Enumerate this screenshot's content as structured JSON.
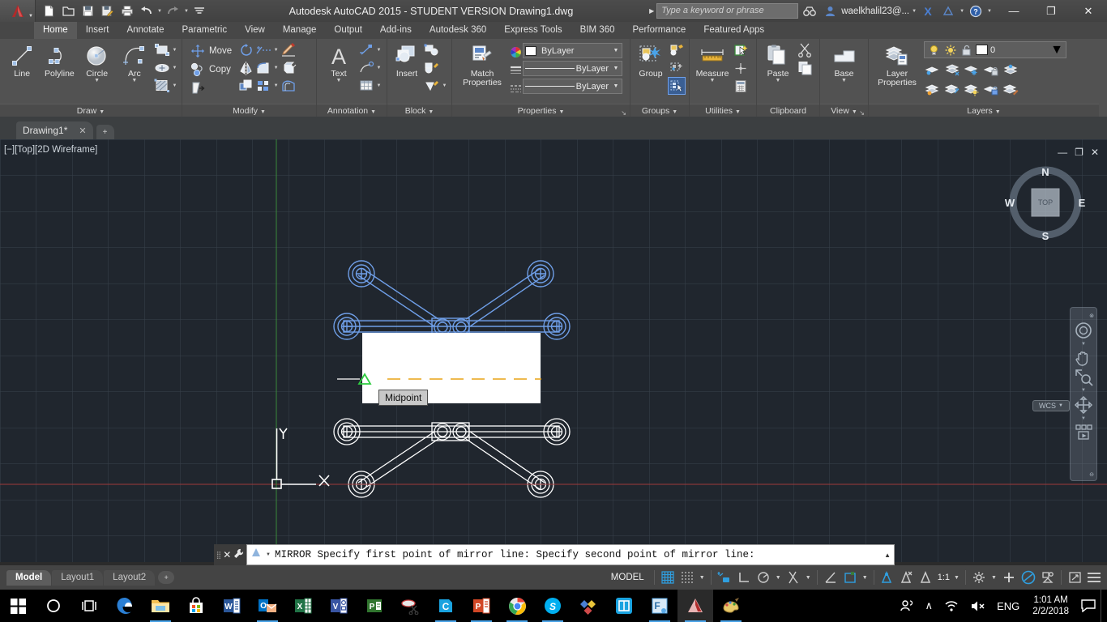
{
  "titlebar": {
    "app_icon": "autocad-a-logo",
    "title": "Autodesk AutoCAD 2015 - STUDENT VERSION    Drawing1.dwg",
    "quick_access": [
      {
        "name": "new-file",
        "glyph": "὜B"
      },
      {
        "name": "open-file",
        "glyph": "὜1"
      },
      {
        "name": "save-file",
        "glyph": "ὋE"
      },
      {
        "name": "save-as-file",
        "glyph": "὜A"
      },
      {
        "name": "plot-print",
        "glyph": "὚8"
      },
      {
        "name": "undo",
        "glyph": "↶"
      },
      {
        "name": "redo",
        "glyph": "↷"
      },
      {
        "name": "customize-qat",
        "glyph": "▾"
      }
    ],
    "search_placeholder": "Type a keyword or phrase",
    "search_value": "",
    "sign_in_user": "waelkhalil23@...",
    "help_label": "?",
    "window_buttons": {
      "minimize": "—",
      "maximize": "❐",
      "close": "✕"
    }
  },
  "ribbon": {
    "tabs": [
      {
        "label": "Home",
        "active": true
      },
      {
        "label": "Insert",
        "active": false
      },
      {
        "label": "Annotate",
        "active": false
      },
      {
        "label": "Parametric",
        "active": false
      },
      {
        "label": "View",
        "active": false
      },
      {
        "label": "Manage",
        "active": false
      },
      {
        "label": "Output",
        "active": false
      },
      {
        "label": "Add-ins",
        "active": false
      },
      {
        "label": "Autodesk 360",
        "active": false
      },
      {
        "label": "Express Tools",
        "active": false
      },
      {
        "label": "BIM 360",
        "active": false
      },
      {
        "label": "Performance",
        "active": false
      },
      {
        "label": "Featured Apps",
        "active": false
      }
    ],
    "panels": {
      "draw": {
        "title": "Draw",
        "buttons": [
          {
            "label": "Line",
            "icon": "line-icon"
          },
          {
            "label": "Polyline",
            "icon": "polyline-icon"
          },
          {
            "label": "Circle",
            "icon": "circle-icon"
          },
          {
            "label": "Arc",
            "icon": "arc-icon"
          }
        ],
        "small_icons": [
          "rectangle-icon",
          "ellipse-icon",
          "hatch-icon"
        ]
      },
      "modify": {
        "title": "Modify",
        "buttons": [
          {
            "label": "Move",
            "icon": "move-icon"
          },
          {
            "label": "Copy",
            "icon": "copy-icon"
          }
        ],
        "small_icons": [
          "stretch-icon",
          "rotate-icon",
          "trim-icon",
          "erase-icon",
          "mirror-icon",
          "fillet-icon",
          "explode-icon",
          "scale-icon",
          "array-icon",
          "offset-icon"
        ]
      },
      "annotation": {
        "title": "Annotation",
        "buttons": [
          {
            "label": "Text",
            "icon": "text-a-icon"
          }
        ],
        "small_icons": [
          "dimension-icon",
          "leader-icon",
          "table-icon"
        ]
      },
      "block": {
        "title": "Block",
        "buttons": [
          {
            "label": "Insert",
            "icon": "insert-block-icon"
          }
        ],
        "small_icons": [
          "create-block-icon",
          "edit-block-icon",
          "define-attribute-icon"
        ]
      },
      "properties": {
        "title": "Properties",
        "buttons": [
          {
            "label": "Match\nProperties",
            "icon": "match-properties-icon"
          }
        ],
        "combos": [
          {
            "name": "object-color",
            "value": "ByLayer",
            "icon": "color-wheel-icon",
            "swatch": "#ffffff"
          },
          {
            "name": "linewidth",
            "value": "ByLayer",
            "icon": "lineweight-icon"
          },
          {
            "name": "linetype",
            "value": "ByLayer",
            "icon": "linetype-icon"
          }
        ]
      },
      "groups": {
        "title": "Groups",
        "buttons": [
          {
            "label": "Group",
            "icon": "group-icon"
          }
        ],
        "small_icons": [
          "ungroup-icon",
          "group-edit-icon",
          "group-selection-on-off-icon"
        ]
      },
      "utilities": {
        "title": "Utilities",
        "buttons": [
          {
            "label": "Measure",
            "icon": "measure-ruler-icon"
          }
        ],
        "small_icons": [
          "quick-select-icon",
          "point-style-icon",
          "calculator-icon"
        ]
      },
      "clipboard": {
        "title": "Clipboard",
        "buttons": [
          {
            "label": "Paste",
            "icon": "paste-icon"
          }
        ],
        "small_icons": [
          "cut-icon",
          "copy-clip-icon"
        ]
      },
      "view": {
        "title": "View",
        "buttons": [
          {
            "label": "Base",
            "icon": "base-view-icon"
          }
        ]
      },
      "layers": {
        "title": "Layers",
        "buttons": [
          {
            "label": "Layer\nProperties",
            "icon": "layer-properties-icon"
          }
        ],
        "layer_combo": {
          "value": "0",
          "swatch": "#ffffff",
          "state_icons": [
            "layer-on-bulb-icon",
            "layer-thaw-sun-icon",
            "layer-unlock-icon"
          ]
        },
        "small_icons": [
          "layer-isolate-icon",
          "layer-freeze-icon",
          "layer-freeze-vp-icon",
          "layer-lock-icon",
          "layer-merge-icon",
          "layer-unisolate-icon",
          "layer-off-icon",
          "layer-thaw-all-icon",
          "layer-unlock-all-icon",
          "layer-change-to-current-icon"
        ]
      }
    }
  },
  "doctabs": {
    "tabs": [
      {
        "label": "Drawing1*",
        "close": "✕",
        "active": true
      }
    ],
    "new_tab": "+"
  },
  "canvas": {
    "viewport_label": "[−][Top][2D Wireframe]",
    "viewport_controls": {
      "minimize": "—",
      "maximize": "❐",
      "close": "✕"
    },
    "viewcube": {
      "top": "TOP",
      "n": "N",
      "e": "E",
      "s": "S",
      "w": "W"
    },
    "wcs_label": "WCS",
    "nav_tools": [
      "steering-wheel-icon",
      "pan-hand-icon",
      "zoom-extents-icon",
      "orbit-icon",
      "showmotion-icon"
    ],
    "osnap_tooltip": "Midpoint",
    "ucs": {
      "x_label": "X",
      "y_label": "Y"
    },
    "colors": {
      "background": "#20262e",
      "grid_line": "#39404a",
      "selected_geometry": "#6f9fe8",
      "unselected_geometry": "#ffffff",
      "mirror_line": "#e8a317",
      "x_axis": "#b03a3a",
      "y_axis": "#3aa03a",
      "osnap_marker": "#2ecc40"
    }
  },
  "command_line": {
    "prompt": "MIRROR Specify first point of mirror line: Specify second point of mirror line:",
    "close_icon": "✕",
    "options_icon": "customize-wrench-icon",
    "expand_icon": "▲"
  },
  "statusbar": {
    "layout_tabs": [
      {
        "label": "Model",
        "active": true
      },
      {
        "label": "Layout1",
        "active": false
      },
      {
        "label": "Layout2",
        "active": false
      }
    ],
    "new_layout": "+",
    "space_label": "MODEL",
    "scale": "1:1",
    "toggles": [
      {
        "name": "grid-display-toggle",
        "on": true
      },
      {
        "name": "snap-mode-toggle",
        "on": false
      },
      {
        "name": "infer-constraints-toggle",
        "on": true
      },
      {
        "name": "ortho-mode-toggle",
        "on": false
      },
      {
        "name": "polar-tracking-toggle",
        "on": false
      },
      {
        "name": "object-snap-toggle",
        "on": false
      },
      {
        "name": "object-snap-tracking-toggle",
        "on": false
      },
      {
        "name": "dynamic-ucs-toggle",
        "on": false
      },
      {
        "name": "annotation-visibility-toggle",
        "on": true
      },
      {
        "name": "autoscale-toggle",
        "on": true
      },
      {
        "name": "annotation-scale-toggle",
        "on": true
      },
      {
        "name": "workspace-switching-icon",
        "on": false
      },
      {
        "name": "hardware-acceleration-icon",
        "on": false
      },
      {
        "name": "isolate-objects-icon",
        "on": true
      },
      {
        "name": "clean-screen-icon",
        "on": false
      },
      {
        "name": "customization-menu-icon",
        "on": false
      }
    ]
  },
  "taskbar": {
    "items": [
      {
        "name": "start-button",
        "glyph": "⊞",
        "color": "#ffffff",
        "active": false,
        "running": false
      },
      {
        "name": "cortana-search-icon",
        "glyph": "◯",
        "color": "#ffffff",
        "active": false,
        "running": false
      },
      {
        "name": "task-view-icon",
        "glyph": "❐",
        "color": "#ffffff",
        "active": false,
        "running": false
      },
      {
        "name": "edge-browser-icon",
        "glyph": "e",
        "color": "#2b7fd4",
        "active": false,
        "running": false
      },
      {
        "name": "file-explorer-icon",
        "glyph": "Ὄ1",
        "color": "#f5c255",
        "active": false,
        "running": true
      },
      {
        "name": "microsoft-store-icon",
        "glyph": "ὬD",
        "color": "#ffffff",
        "active": false,
        "running": false
      },
      {
        "name": "word-icon",
        "glyph": "W",
        "color": "#2b579a",
        "active": false,
        "running": false
      },
      {
        "name": "outlook-icon",
        "glyph": "O",
        "color": "#0072c6",
        "active": false,
        "running": true
      },
      {
        "name": "excel-icon",
        "glyph": "X",
        "color": "#217346",
        "active": false,
        "running": false
      },
      {
        "name": "visio-icon",
        "glyph": "V",
        "color": "#3955a3",
        "active": false,
        "running": false
      },
      {
        "name": "project-icon",
        "glyph": "P",
        "color": "#31752f",
        "active": false,
        "running": false
      },
      {
        "name": "snipping-tool-icon",
        "glyph": "✂",
        "color": "#cfcfcf",
        "active": false,
        "running": false
      },
      {
        "name": "camtasia-icon",
        "glyph": "C",
        "color": "#1aa3e0",
        "active": false,
        "running": true
      },
      {
        "name": "powerpoint-icon",
        "glyph": "P",
        "color": "#d24726",
        "active": false,
        "running": true
      },
      {
        "name": "chrome-icon",
        "glyph": "◉",
        "color": "#4285f4",
        "active": false,
        "running": true
      },
      {
        "name": "skype-icon",
        "glyph": "S",
        "color": "#00aff0",
        "active": false,
        "running": true
      },
      {
        "name": "autodesk-desktop-icon",
        "glyph": "◆",
        "color": "#e8b33a",
        "active": false,
        "running": false
      },
      {
        "name": "navisworks-icon",
        "glyph": "▣",
        "color": "#1aa3e0",
        "active": false,
        "running": false
      },
      {
        "name": "formit-icon",
        "glyph": "F",
        "color": "#5aa9e6",
        "active": false,
        "running": true
      },
      {
        "name": "autocad-icon",
        "glyph": "▲",
        "color": "#c0392b",
        "active": true,
        "running": true
      },
      {
        "name": "paint-icon",
        "glyph": "Ἲ8",
        "color": "#e8b33a",
        "active": false,
        "running": true
      }
    ],
    "tray": {
      "people_icon": "ʘ",
      "show_hidden_icon": "∧",
      "network_icon": "wifi-icon",
      "volume_icon": "speaker-muted-icon",
      "language": "ENG",
      "time": "1:01 AM",
      "date": "2/2/2018",
      "action_center_icon": "notification-icon"
    }
  }
}
